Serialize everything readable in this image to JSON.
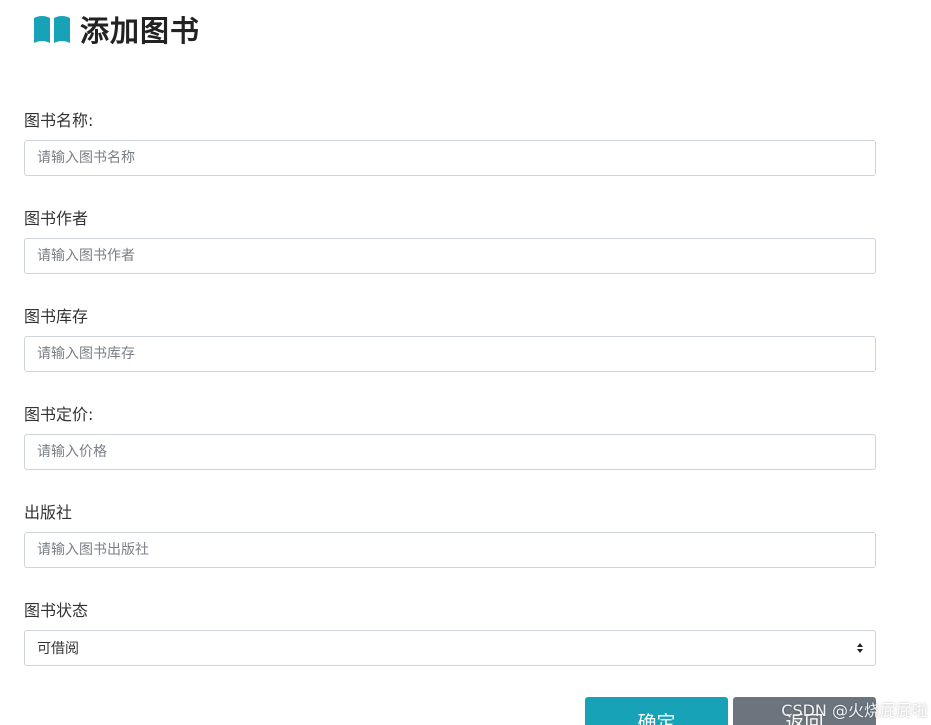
{
  "header": {
    "title": "添加图书",
    "icon": "book-open-icon",
    "icon_color": "#17a2b8"
  },
  "form": {
    "fields": [
      {
        "label": "图书名称:",
        "placeholder": "请输入图书名称"
      },
      {
        "label": "图书作者",
        "placeholder": "请输入图书作者"
      },
      {
        "label": "图书库存",
        "placeholder": "请输入图书库存"
      },
      {
        "label": "图书定价:",
        "placeholder": "请输入价格"
      },
      {
        "label": "出版社",
        "placeholder": "请输入图书出版社"
      }
    ],
    "status": {
      "label": "图书状态",
      "selected": "可借阅"
    }
  },
  "buttons": {
    "confirm_label": "确定",
    "back_label": "返回",
    "confirm_color": "#17a2b8",
    "back_color": "#6c757d"
  },
  "watermark": "CSDN @火烧屁屁啦"
}
